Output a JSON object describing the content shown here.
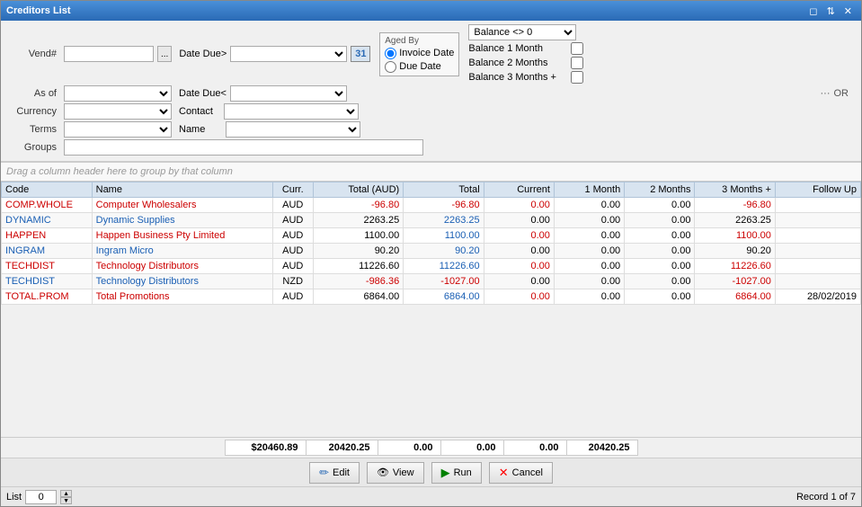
{
  "window": {
    "title": "Creditors List",
    "controls": [
      "restore",
      "move",
      "close"
    ]
  },
  "filters": {
    "vend_label": "Vend#",
    "as_of_label": "As of",
    "currency_label": "Currency",
    "terms_label": "Terms",
    "groups_label": "Groups",
    "date_due_gt_label": "Date Due>",
    "date_due_lt_label": "Date Due<",
    "contact_label": "Contact",
    "name_label": "Name",
    "vend_value": "",
    "as_of_value": "",
    "currency_value": "",
    "terms_value": "",
    "groups_value": "",
    "date_due_gt_value": "",
    "date_due_lt_value": "",
    "contact_value": "",
    "name_value": "",
    "date_btn_icon": "31",
    "aged_by_label": "Aged By",
    "invoice_date_label": "Invoice Date",
    "due_date_label": "Due Date",
    "balance_filter_label": "Balance <> 0",
    "balance_1_month_label": "Balance 1 Month",
    "balance_2_months_label": "Balance 2 Months",
    "balance_3_months_label": "Balance 3 Months +",
    "or_label": "OR",
    "ellipsis": "..."
  },
  "drag_hint": "Drag a column header here to group by that column",
  "table": {
    "columns": [
      "Code",
      "Name",
      "Curr.",
      "Total (AUD)",
      "Total",
      "Current",
      "1 Month",
      "2 Months",
      "3 Months +",
      "Follow Up"
    ],
    "rows": [
      {
        "code": "COMP.WHOLE",
        "name": "Computer Wholesalers",
        "curr": "AUD",
        "total_aud": "-96.80",
        "total": "-96.80",
        "current": "0.00",
        "m1": "0.00",
        "m2": "0.00",
        "m3": "-96.80",
        "follow_up": "",
        "color": "red"
      },
      {
        "code": "DYNAMIC",
        "name": "Dynamic Supplies",
        "curr": "AUD",
        "total_aud": "2263.25",
        "total": "2263.25",
        "current": "0.00",
        "m1": "0.00",
        "m2": "0.00",
        "m3": "2263.25",
        "follow_up": "",
        "color": "blue"
      },
      {
        "code": "HAPPEN",
        "name": "Happen Business Pty Limited",
        "curr": "AUD",
        "total_aud": "1100.00",
        "total": "1100.00",
        "current": "0.00",
        "m1": "0.00",
        "m2": "0.00",
        "m3": "1100.00",
        "follow_up": "",
        "color": "red"
      },
      {
        "code": "INGRAM",
        "name": "Ingram Micro",
        "curr": "AUD",
        "total_aud": "90.20",
        "total": "90.20",
        "current": "0.00",
        "m1": "0.00",
        "m2": "0.00",
        "m3": "90.20",
        "follow_up": "",
        "color": "blue"
      },
      {
        "code": "TECHDIST",
        "name": "Technology Distributors",
        "curr": "AUD",
        "total_aud": "11226.60",
        "total": "11226.60",
        "current": "0.00",
        "m1": "0.00",
        "m2": "0.00",
        "m3": "11226.60",
        "follow_up": "",
        "color": "red"
      },
      {
        "code": "TECHDIST",
        "name": "Technology Distributors",
        "curr": "NZD",
        "total_aud": "-986.36",
        "total": "-1027.00",
        "current": "0.00",
        "m1": "0.00",
        "m2": "0.00",
        "m3": "-1027.00",
        "follow_up": "",
        "color": "blue"
      },
      {
        "code": "TOTAL.PROM",
        "name": "Total Promotions",
        "curr": "AUD",
        "total_aud": "6864.00",
        "total": "6864.00",
        "current": "0.00",
        "m1": "0.00",
        "m2": "0.00",
        "m3": "6864.00",
        "follow_up": "28/02/2019",
        "color": "red"
      }
    ],
    "footer": {
      "total_aud": "$20460.89",
      "total": "20420.25",
      "current": "0.00",
      "m1": "0.00",
      "m2": "0.00",
      "m3": "20420.25"
    }
  },
  "actions": {
    "edit_label": "Edit",
    "view_label": "View",
    "run_label": "Run",
    "cancel_label": "Cancel"
  },
  "status": {
    "list_label": "List",
    "list_value": "0",
    "record_info": "Record 1 of 7"
  }
}
